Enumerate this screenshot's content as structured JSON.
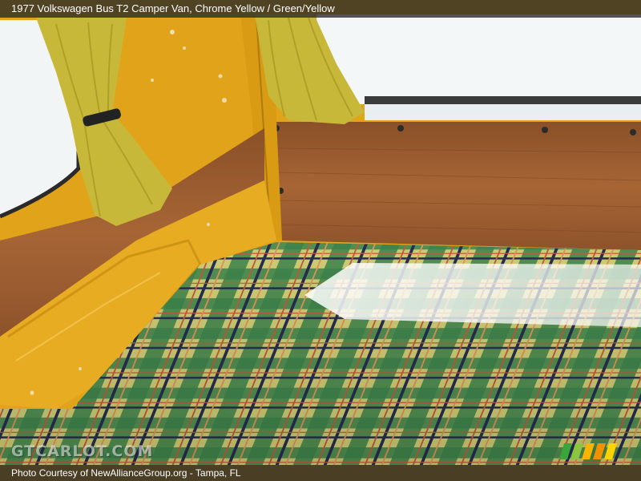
{
  "caption": {
    "vehicle": "1977 Volkswagen Bus T2 Camper Van,",
    "colors": "Chrome Yellow / Green/Yellow"
  },
  "watermark": {
    "text": "GTCARLOT.COM"
  },
  "footer": {
    "credit": "Photo Courtesy of NewAllianceGroup.org - Tampa, FL"
  },
  "photo": {
    "palette": {
      "body_paint": "#e0a319",
      "wood_panel": "#9a5b2c",
      "plaid_green": "#3f8a4f",
      "plaid_yellow": "#d9d67a",
      "plaid_navy": "#2a2f55",
      "plaid_red": "#c9603e",
      "curtain": "#c8b83a",
      "window": "#f4f7f8"
    }
  },
  "logo": {
    "name": "gtcarlot-stripes-logo",
    "colors": [
      "#3aa53a",
      "#8cc63f",
      "#f7b500",
      "#f29100",
      "#ffd200"
    ]
  }
}
